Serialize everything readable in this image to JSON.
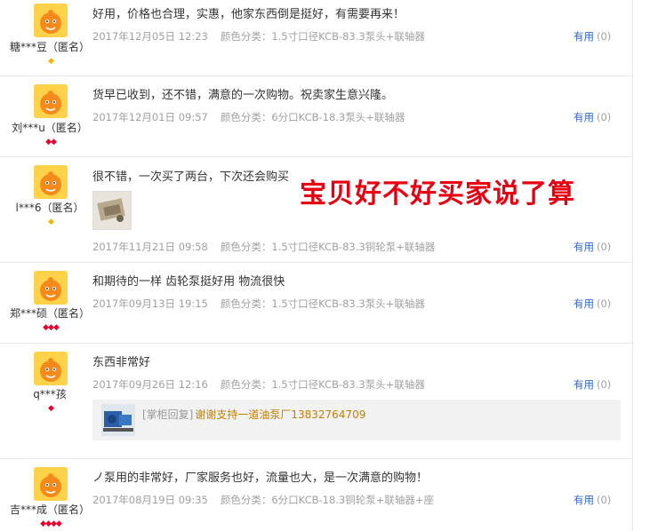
{
  "helpful_label": "有用",
  "helpful_count": "(0)",
  "reply_prefix": "[掌柜回复]",
  "overlay_text": "宝贝好不好买家说了算",
  "colors": {
    "diamond_yellow": "#f5b400",
    "diamond_red": "#e6002d",
    "helpful_blue": "#3366cc",
    "reply_text": "#c08000",
    "overlay_red": "#e60012"
  },
  "reviews": [
    {
      "user": "糖***豆（匿名）",
      "content": "好用，价格也合理，实惠，他家东西倒是挺好，有需要再来！",
      "date": "2017年12月05日 12:23",
      "sku": "颜色分类：1.5寸口径KCB-83.3泵头+联轴器"
    },
    {
      "user": "刘***u（匿名）",
      "content": "货早已收到，还不错，满意的一次购物。祝卖家生意兴隆。",
      "date": "2017年12月01日 09:57",
      "sku": "颜色分类：6分口KCB-18.3泵头+联轴器"
    },
    {
      "user": "l***6（匿名）",
      "content": "很不错，一次买了两台，下次还会购买",
      "date": "2017年11月21日 09:58",
      "sku": "颜色分类：1.5寸口径KCB-83.3铜轮泵+联轴器"
    },
    {
      "user": "郑***硕（匿名）",
      "content": "和期待的一样 齿轮泵挺好用 物流很快",
      "date": "2017年09月13日 19:15",
      "sku": "颜色分类：1.5寸口径KCB-83.3泵头+联轴器"
    },
    {
      "user": "q***孩",
      "content": "东西非常好",
      "date": "2017年09月26日 12:16",
      "sku": "颜色分类：1.5寸口径KCB-83.3泵头+联轴器",
      "reply": "谢谢支持一道油泵厂13832764709"
    },
    {
      "user": "吉***成（匿名）",
      "content": "ノ泵用的非常好，厂家服务也好，流量也大，是一次满意的购物！",
      "date": "2017年08月19日 09:35",
      "sku": "颜色分类：6分口KCB-18.3铜轮泵+联轴器+座"
    }
  ]
}
